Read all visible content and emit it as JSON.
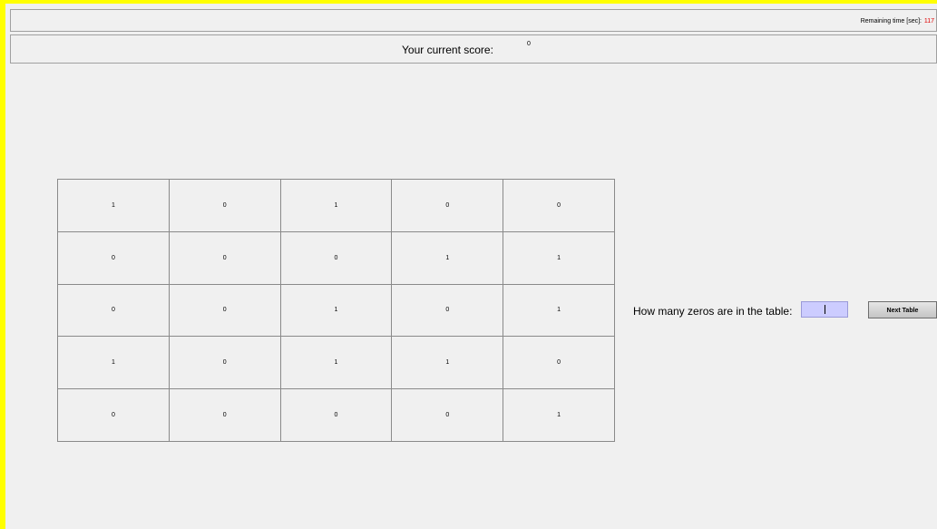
{
  "timer": {
    "label": "Remaining time [sec]:",
    "value": "117",
    "value_color": "#e00000"
  },
  "score": {
    "label": "Your current score:",
    "value": "0"
  },
  "table": {
    "rows": [
      [
        "1",
        "0",
        "1",
        "0",
        "0"
      ],
      [
        "0",
        "0",
        "0",
        "1",
        "1"
      ],
      [
        "0",
        "0",
        "1",
        "0",
        "1"
      ],
      [
        "1",
        "0",
        "1",
        "1",
        "0"
      ],
      [
        "0",
        "0",
        "0",
        "0",
        "1"
      ]
    ]
  },
  "question": {
    "label": "How many zeros are in the table:",
    "input_value": ""
  },
  "next_button": {
    "label": "Next Table"
  },
  "colors": {
    "frame": "#ffff00",
    "background": "#f0f0f0",
    "input_background": "#ccccff"
  }
}
